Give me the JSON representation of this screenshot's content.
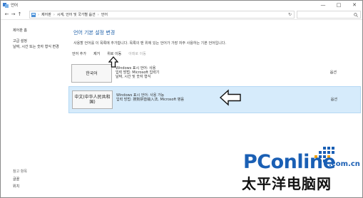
{
  "window": {
    "title": "언어",
    "controls": {
      "minimize": "—",
      "maximize": "□",
      "close": "✕"
    }
  },
  "address": {
    "back": "←",
    "forward": "→",
    "up": "↑",
    "crumbs": [
      "제어판",
      "시계, 언어 및 국가별 옵션",
      "언어"
    ],
    "separator": "›",
    "refresh": "↻",
    "search_icon": "search-icon"
  },
  "sidebar": {
    "home": "제어판 홈",
    "advanced": "고급 설정",
    "datetime": "날짜, 시간 또는 숫자 형식 변경",
    "see_also": "참고 항목",
    "fonts": "글꼴",
    "location": "위치"
  },
  "main": {
    "heading": "언어 기본 설정 변경",
    "description": "사용할 언어를 이 목록에 추가합니다. 목록의 맨 위에 있는 언어가 가장 자주 사용하는 기본 언어입니다.",
    "toolbar": {
      "add": "언어 추가",
      "remove": "제거",
      "move_up": "위로 이동",
      "move_down": "아래로 이동"
    },
    "languages": [
      {
        "name": "한국어",
        "line1": "Windows 표시 언어: 사용",
        "line2": "입력 방법: Microsoft 입력기",
        "line3": "날짜, 시간 및 숫자 형식",
        "options": "옵션"
      },
      {
        "name": "中文(中华人民共和国)",
        "line1": "Windows 표시 언어: 사용 가능",
        "line2": "입력 방법: 搜狗拼音输入法, Microsoft 병음",
        "options": "옵션"
      }
    ]
  },
  "watermark": {
    "brand": "PConline",
    "domain": ".com.cn",
    "cn_name": "太平洋电脑网"
  },
  "colors": {
    "heading_blue": "#1c5fa8",
    "selected_row": "#d6ebfb",
    "brand_blue": "#1a5fb4"
  }
}
